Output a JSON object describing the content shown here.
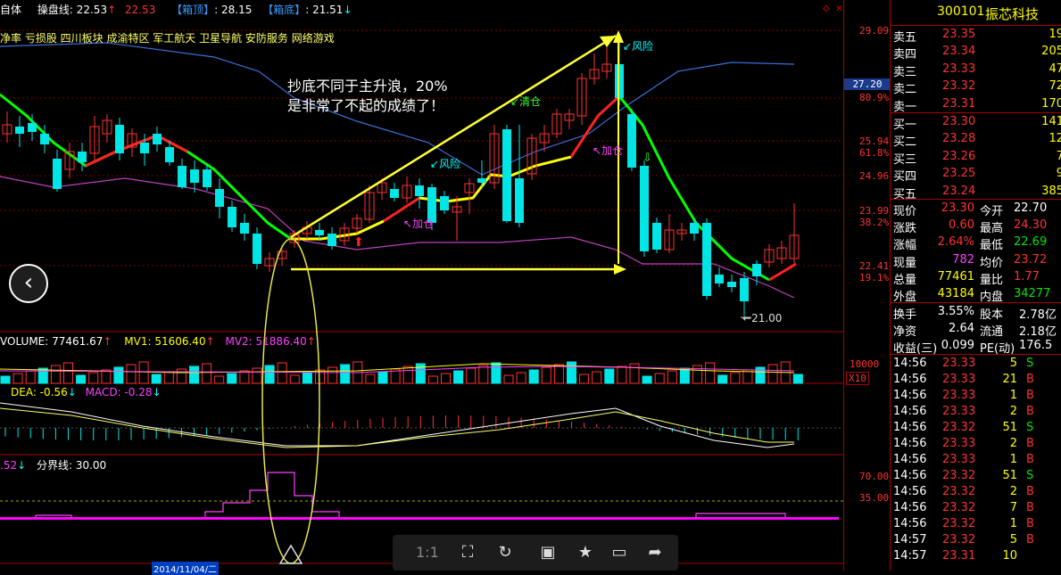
{
  "header": {
    "title_fragment": "自体",
    "indicator_name": "操盘线:",
    "indicator_val1": "22.53",
    "indicator_val2": "22.53",
    "box_top_label": "【箱顶】",
    "box_top_val": ": 28.15",
    "box_bottom_label": "【箱底】",
    "box_bottom_val": ": 21.51",
    "sectors": "净率 亏损股 四川板块 成渝特区 军工航天 卫星导航 安防服务 网络游戏"
  },
  "annotations": {
    "main_note_line1": "抄底不同于主升浪，20%",
    "main_note_line2": "是非常了不起的成绩了！",
    "risk1": "风险",
    "risk2": "风险",
    "clear": "清仓",
    "add1": "加仓",
    "add2": "加仓",
    "low_mark": "21.00",
    "highlight_price": "27.20"
  },
  "right_axis": {
    "p1": "29.09",
    "p2": "25.94",
    "p2pct": "61.8%",
    "p3": "24.96",
    "p4": "23.99",
    "p4pct": "38.2%",
    "p5": "22.41",
    "p5pct": "19.1%",
    "p0pct": "80.9%",
    "vol": "10000",
    "x10": "X10",
    "k70": "70.00",
    "k35": "35.00"
  },
  "volume_bar": {
    "volume": "VOLUME: 77461.67",
    "mv1": "MV1: 51606.40",
    "mv2": "MV2: 51886.40"
  },
  "macd_bar": {
    "dea": "DEA: -0.56",
    "macd": "MACD: -0.28"
  },
  "kd_bar": {
    "val": ".52",
    "line": "分界线: 30.00"
  },
  "date_fragment": "2014/11/04/二",
  "quote": {
    "code": "300101",
    "name": "振芯科技",
    "asks": [
      {
        "label": "卖五",
        "price": "23.35",
        "vol": "19"
      },
      {
        "label": "卖四",
        "price": "23.34",
        "vol": "205"
      },
      {
        "label": "卖三",
        "price": "23.33",
        "vol": "47"
      },
      {
        "label": "卖二",
        "price": "23.32",
        "vol": "72"
      },
      {
        "label": "卖一",
        "price": "23.31",
        "vol": "170"
      }
    ],
    "bids": [
      {
        "label": "买一",
        "price": "23.30",
        "vol": "141"
      },
      {
        "label": "买二",
        "price": "23.28",
        "vol": "12"
      },
      {
        "label": "买三",
        "price": "23.26",
        "vol": "7"
      },
      {
        "label": "买四",
        "price": "23.25",
        "vol": "9"
      },
      {
        "label": "买五",
        "price": "23.24",
        "vol": "385"
      }
    ],
    "stats": [
      {
        "l1": "现价",
        "v1": "23.30",
        "l2": "今开",
        "v2": "22.70"
      },
      {
        "l1": "涨跌",
        "v1": "0.60",
        "l2": "最高",
        "v2": "24.30"
      },
      {
        "l1": "涨幅",
        "v1": "2.64%",
        "l2": "最低",
        "v2": "22.69"
      },
      {
        "l1": "现量",
        "v1": "782",
        "l2": "均价",
        "v2": "23.72"
      },
      {
        "l1": "总量",
        "v1": "77461",
        "l2": "量比",
        "v2": "1.77"
      },
      {
        "l1": "外盘",
        "v1": "43184",
        "l2": "内盘",
        "v2": "34277"
      }
    ],
    "stats2": [
      {
        "l1": "换手",
        "v1": "3.55%",
        "l2": "股本",
        "v2": "2.78亿"
      },
      {
        "l1": "净资",
        "v1": "2.64",
        "l2": "流通",
        "v2": "2.18亿"
      },
      {
        "l1": "收益(三)",
        "v1": "0.099",
        "l2": "PE(动)",
        "v2": "176.5"
      }
    ],
    "ticks": [
      {
        "t": "14:56",
        "p": "23.33",
        "v": "5",
        "s": "S"
      },
      {
        "t": "14:56",
        "p": "23.33",
        "v": "21",
        "s": "B"
      },
      {
        "t": "14:56",
        "p": "23.33",
        "v": "1",
        "s": "B"
      },
      {
        "t": "14:56",
        "p": "23.33",
        "v": "2",
        "s": "B"
      },
      {
        "t": "14:56",
        "p": "23.32",
        "v": "51",
        "s": "S"
      },
      {
        "t": "14:56",
        "p": "23.33",
        "v": "2",
        "s": "B"
      },
      {
        "t": "14:56",
        "p": "23.33",
        "v": "1",
        "s": "B"
      },
      {
        "t": "14:56",
        "p": "23.32",
        "v": "51",
        "s": "S"
      },
      {
        "t": "14:56",
        "p": "23.32",
        "v": "2",
        "s": "B"
      },
      {
        "t": "14:56",
        "p": "23.32",
        "v": "7",
        "s": "B"
      },
      {
        "t": "14:56",
        "p": "23.32",
        "v": "1",
        "s": "B"
      },
      {
        "t": "14:57",
        "p": "23.32",
        "v": "5",
        "s": "B"
      },
      {
        "t": "14:57",
        "p": "23.31",
        "v": "10",
        "s": ""
      }
    ]
  },
  "toolbar": {
    "ratio": "1:1"
  },
  "colors": {
    "up": "#ff3232",
    "down": "#00e6e6",
    "ma": "#00ff00",
    "arrow": "#ffff33"
  }
}
